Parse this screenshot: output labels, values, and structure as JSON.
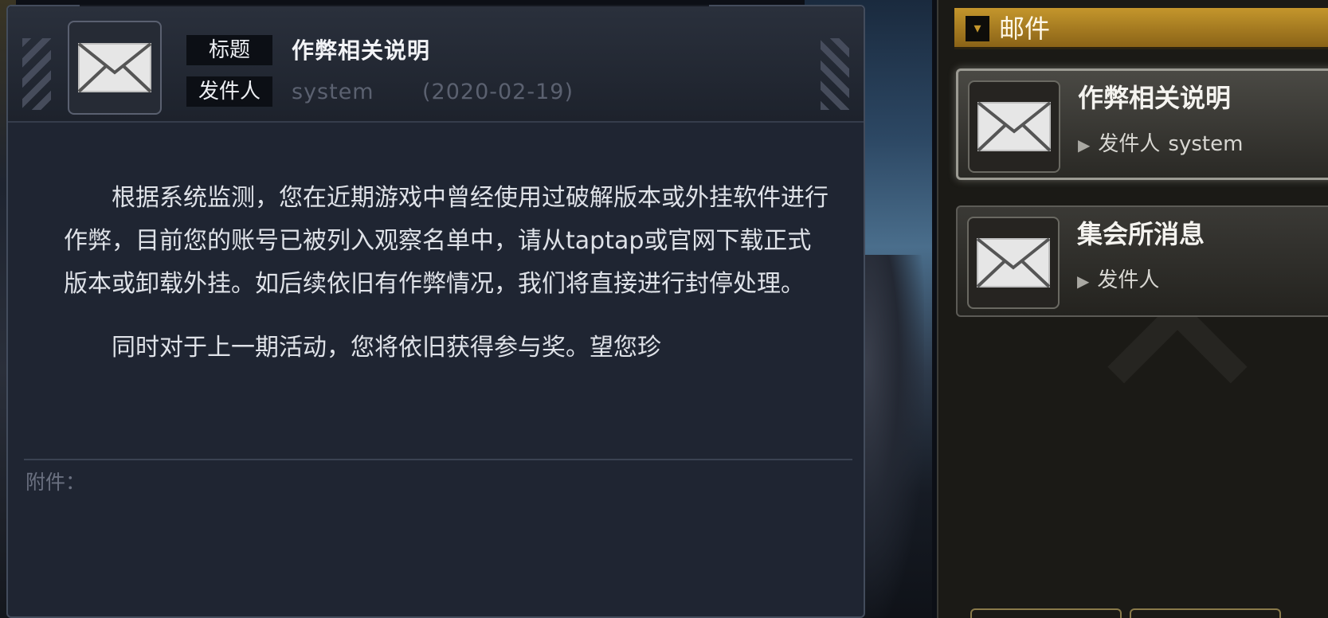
{
  "mail_detail": {
    "title_tag": "标题",
    "sender_tag": "发件人",
    "title": "作弊相关说明",
    "sender": "system",
    "date": "(2020-02-19)",
    "body_paragraphs": [
      "根据系统监测，您在近期游戏中曾经使用过破解版本或外挂软件进行作弊，目前您的账号已被列入观察名单中，请从taptap或官网下载正式版本或卸载外挂。如后续依旧有作弊情况，我们将直接进行封停处理。",
      "同时对于上一期活动，您将依旧获得参与奖。望您珍"
    ],
    "attachment_label": "附件："
  },
  "mail_list": {
    "header_title": "邮件",
    "items": [
      {
        "title": "作弊相关说明",
        "sender_label": "发件人",
        "sender": "system",
        "selected": true
      },
      {
        "title": "集会所消息",
        "sender_label": "发件人",
        "sender": "",
        "selected": false
      }
    ]
  },
  "icons": {
    "mail": "envelope-icon",
    "header": "mailbox-icon",
    "arrow": "triangle-right-icon"
  },
  "colors": {
    "accent_gold": "#c4962c",
    "panel_bg": "#1f2532",
    "list_bg": "#1b1a16"
  }
}
